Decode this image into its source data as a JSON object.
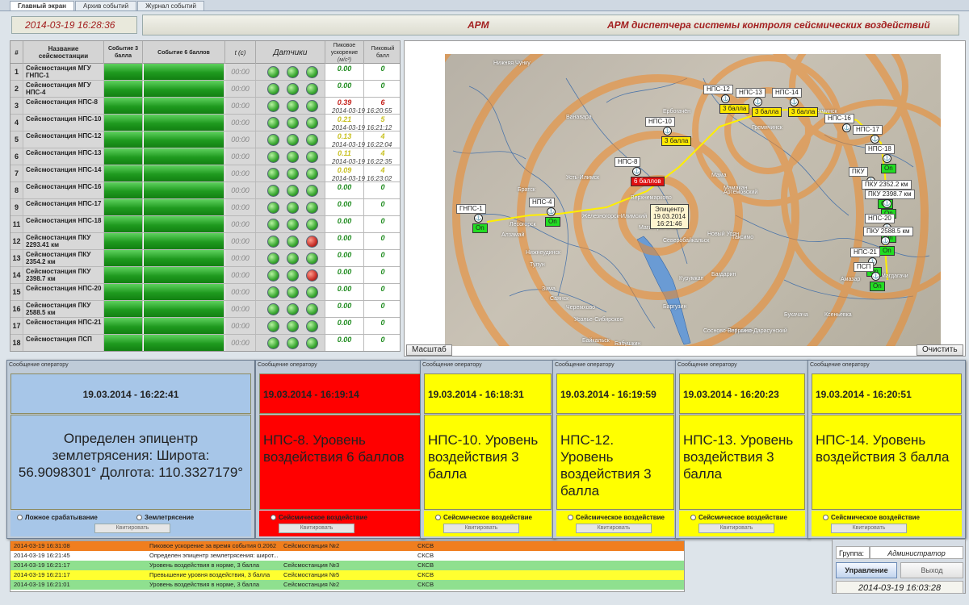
{
  "tabs": [
    {
      "label": "Главный экран"
    },
    {
      "label": "Архив событий"
    },
    {
      "label": "Журнал событий"
    }
  ],
  "clock": "2014-03-19 16:28:36",
  "title": {
    "short": "АРМ",
    "full": "АРМ диспетчера системы контроля сейсмических воздействий"
  },
  "grid": {
    "headers": {
      "num": "#",
      "name": "Название сейсмостанции",
      "ev3": "Событие 3 балла",
      "ev6": "Событие 6 баллов",
      "t": "t (c)",
      "sensors": "Датчики",
      "peak_acc": "Пиковое ускорение",
      "peak_acc_unit": "(м/с²)",
      "peak_ball": "Пиковый балл"
    },
    "rows": [
      {
        "n": "1",
        "name": "Сейсмостанция МГУ ГНПС-1",
        "t": "00:00",
        "acc": "0.00",
        "ball": "0",
        "ts": "",
        "lvl": "g",
        "s3": "g"
      },
      {
        "n": "2",
        "name": "Сейсмостанция МГУ НПС-4",
        "t": "00:00",
        "acc": "0.00",
        "ball": "0",
        "ts": "",
        "lvl": "g",
        "s3": "g"
      },
      {
        "n": "3",
        "name": "Сейсмостанция НПС-8",
        "t": "00:00",
        "acc": "0.39",
        "ball": "6",
        "ts": "2014-03-19 16:20:55",
        "lvl": "r",
        "s3": "g"
      },
      {
        "n": "4",
        "name": "Сейсмостанция НПС-10",
        "t": "00:00",
        "acc": "0.21",
        "ball": "5",
        "ts": "2014-03-19 16:21:12",
        "lvl": "y",
        "s3": "g"
      },
      {
        "n": "5",
        "name": "Сейсмостанция НПС-12",
        "t": "00:00",
        "acc": "0.13",
        "ball": "4",
        "ts": "2014-03-19 16:22:04",
        "lvl": "y",
        "s3": "g"
      },
      {
        "n": "6",
        "name": "Сейсмостанция НПС-13",
        "t": "00:00",
        "acc": "0.11",
        "ball": "4",
        "ts": "2014-03-19 16:22:35",
        "lvl": "y",
        "s3": "g"
      },
      {
        "n": "7",
        "name": "Сейсмостанция НПС-14",
        "t": "00:00",
        "acc": "0.09",
        "ball": "4",
        "ts": "2014-03-19 16:23:02",
        "lvl": "y",
        "s3": "g"
      },
      {
        "n": "8",
        "name": "Сейсмостанция НПС-16",
        "t": "00:00",
        "acc": "0.00",
        "ball": "0",
        "ts": "",
        "lvl": "g",
        "s3": "g"
      },
      {
        "n": "9",
        "name": "Сейсмостанция НПС-17",
        "t": "00:00",
        "acc": "0.00",
        "ball": "0",
        "ts": "",
        "lvl": "g",
        "s3": "g"
      },
      {
        "n": "11",
        "name": "Сейсмостанция НПС-18",
        "t": "00:00",
        "acc": "0.00",
        "ball": "0",
        "ts": "",
        "lvl": "g",
        "s3": "g"
      },
      {
        "n": "12",
        "name": "Сейсмостанция ПКУ 2293.41 км",
        "t": "00:00",
        "acc": "0.00",
        "ball": "0",
        "ts": "",
        "lvl": "g",
        "s3": "r"
      },
      {
        "n": "13",
        "name": "Сейсмостанция ПКУ 2354.2 км",
        "t": "00:00",
        "acc": "0.00",
        "ball": "0",
        "ts": "",
        "lvl": "g",
        "s3": "g"
      },
      {
        "n": "14",
        "name": "Сейсмостанция ПКУ 2398.7 км",
        "t": "00:00",
        "acc": "0.00",
        "ball": "0",
        "ts": "",
        "lvl": "g",
        "s3": "r"
      },
      {
        "n": "15",
        "name": "Сейсмостанция НПС-20",
        "t": "00:00",
        "acc": "0.00",
        "ball": "0",
        "ts": "",
        "lvl": "g",
        "s3": "g"
      },
      {
        "n": "16",
        "name": "Сейсмостанция ПКУ 2588.5 км",
        "t": "00:00",
        "acc": "0.00",
        "ball": "0",
        "ts": "",
        "lvl": "g",
        "s3": "g"
      },
      {
        "n": "17",
        "name": "Сейсмостанция НПС-21",
        "t": "00:00",
        "acc": "0.00",
        "ball": "0",
        "ts": "",
        "lvl": "g",
        "s3": "g"
      },
      {
        "n": "18",
        "name": "Сейсмостанция ПСП",
        "t": "00:00",
        "acc": "0.00",
        "ball": "0",
        "ts": "",
        "lvl": "g",
        "s3": "g"
      }
    ]
  },
  "map": {
    "scale_button": "Масштаб",
    "clear_button": "Очистить",
    "epicenter": {
      "title": "Эпицентр",
      "date": "19.03.2014",
      "time": "16:21:46"
    },
    "towns": [
      "Нижняя Чунку",
      "Ванавара",
      "Ербогачён",
      "Усть-Илимск",
      "Братск",
      "Железногорск-Илимский",
      "Верхнемарково",
      "Магистральный",
      "Северобайкальск",
      "Новый Уоян",
      "Таксимо",
      "Мама",
      "Артёмовский",
      "Мамакан",
      "Лесогорск",
      "Алзамай",
      "Нижнеудинск",
      "Тулун",
      "Зима",
      "Саянск",
      "Черемхово",
      "Усолье-Сибирское",
      "Байкальск",
      "Бабушкин",
      "Баргузин",
      "Курумкан",
      "Багдарин",
      "Сосново-Озёрское",
      "Вершино-Дарасунский",
      "Букачача",
      "Ксеньевка",
      "Амазар",
      "Магдагачи",
      "Гремячинск",
      "Олёкминск"
    ],
    "stations": [
      {
        "id": "gnps1",
        "name": "ГНПС-1",
        "badge": "On",
        "c": "g"
      },
      {
        "id": "nps4",
        "name": "НПС-4",
        "badge": "On",
        "c": "g"
      },
      {
        "id": "nps8",
        "name": "НПС-8",
        "badge": "6 баллов",
        "c": "r"
      },
      {
        "id": "nps10",
        "name": "НПС-10",
        "badge": "3 балла",
        "c": "y"
      },
      {
        "id": "nps12",
        "name": "НПС-12",
        "badge": "3 балла",
        "c": "y"
      },
      {
        "id": "nps13",
        "name": "НПС-13",
        "badge": "3 балла",
        "c": "y"
      },
      {
        "id": "nps14",
        "name": "НПС-14",
        "badge": "3 балла",
        "c": "y"
      },
      {
        "id": "nps16",
        "name": "НПС-16",
        "badge": "",
        "c": "g"
      },
      {
        "id": "nps17",
        "name": "НПС-17",
        "badge": "On",
        "c": "g"
      },
      {
        "id": "nps18",
        "name": "НПС-18",
        "badge": "On",
        "c": "g"
      },
      {
        "id": "pku1",
        "name": "ПКУ",
        "badge": "On",
        "c": "g"
      },
      {
        "id": "pku2354",
        "name": "ПКУ 2352.2 км",
        "badge": "On",
        "c": "g"
      },
      {
        "id": "pku2398",
        "name": "ПКУ 2398.7 км",
        "badge": "On",
        "c": "g"
      },
      {
        "id": "nps20",
        "name": "НПС-20",
        "badge": "On",
        "c": "g"
      },
      {
        "id": "pku2588",
        "name": "ПКУ 2588.5 км",
        "badge": "On",
        "c": "g"
      },
      {
        "id": "nps21",
        "name": "НПС-21",
        "badge": "On",
        "c": "g"
      },
      {
        "id": "psp",
        "name": "ПСП",
        "badge": "On",
        "c": "g"
      }
    ]
  },
  "messages": [
    {
      "caption": "Сообщение оператору",
      "time": "19.03.2014 - 16:22:41",
      "body": "Определен эпицентр землетрясения: Широта: 56.9098301° Долгота: 110.3327179°",
      "r1": "Ложное срабатывание",
      "r2": "Землетрясение",
      "btn": "Квитировать",
      "color": "#a7c6e8"
    },
    {
      "caption": "Сообщение оператору",
      "time": "19.03.2014 - 16:19:14",
      "body": "НПС-8. Уровень воздействия 6 баллов",
      "r1": "",
      "r2": "Сейсмическое воздействие",
      "btn": "Квитировать",
      "color": "#ff0000"
    },
    {
      "caption": "Сообщение оператору",
      "time": "19.03.2014 - 16:18:31",
      "body": "НПС-10. Уровень воздействия 3 балла",
      "r1": "",
      "r2": "Сейсмическое воздействие",
      "btn": "Квитировать",
      "color": "#ffff00"
    },
    {
      "caption": "Сообщение оператору",
      "time": "19.03.2014 - 16:19:59",
      "body": "НПС-12. Уровень воздействия 3 балла",
      "r1": "",
      "r2": "Сейсмическое воздействие",
      "btn": "Квитировать",
      "color": "#ffff00"
    },
    {
      "caption": "Сообщение оператору",
      "time": "19.03.2014 - 16:20:23",
      "body": "НПС-13. Уровень воздействия 3 балла",
      "r1": "",
      "r2": "Сейсмическое воздействие",
      "btn": "Квитировать",
      "color": "#ffff00"
    },
    {
      "caption": "Сообщение оператору",
      "time": "19.03.2014 - 16:20:51",
      "body": "НПС-14. Уровень воздействия 3 балла",
      "r1": "",
      "r2": "Сейсмическое воздействие",
      "btn": "Квитировать",
      "color": "#ffff00"
    }
  ],
  "log": [
    {
      "time": "2014-03-19 16:31:08",
      "msg": "Пиковое ускорение за время события 0.2062",
      "src": "Сейсмостанция №2",
      "type": "СКСВ",
      "bg": "#f07e1e"
    },
    {
      "time": "2014-03-19 16:21:45",
      "msg": "Определен эпицентр землетрясения: широт...",
      "src": "",
      "type": "СКСВ",
      "bg": "#ffffff"
    },
    {
      "time": "2014-03-19 16:21:17",
      "msg": "Уровень воздействия в норме, 3 балла",
      "src": "Сейсмостанция №3",
      "type": "СКСВ",
      "bg": "#8fe08f"
    },
    {
      "time": "2014-03-19 16:21:17",
      "msg": "Превышение уровня воздействия, 3 балла",
      "src": "Сейсмостанция №5",
      "type": "СКСВ",
      "bg": "#ffff30"
    },
    {
      "time": "2014-03-19 16:21:01",
      "msg": "Уровень воздействия в норме, 3 балла",
      "src": "Сейсмостанция №2",
      "type": "СКСВ",
      "bg": "#8fe08f"
    }
  ],
  "side": {
    "group_label": "Группа:",
    "group_value": "Администратор",
    "manage": "Управление",
    "exit": "Выход",
    "time": "2014-03-19 16:03:28"
  }
}
